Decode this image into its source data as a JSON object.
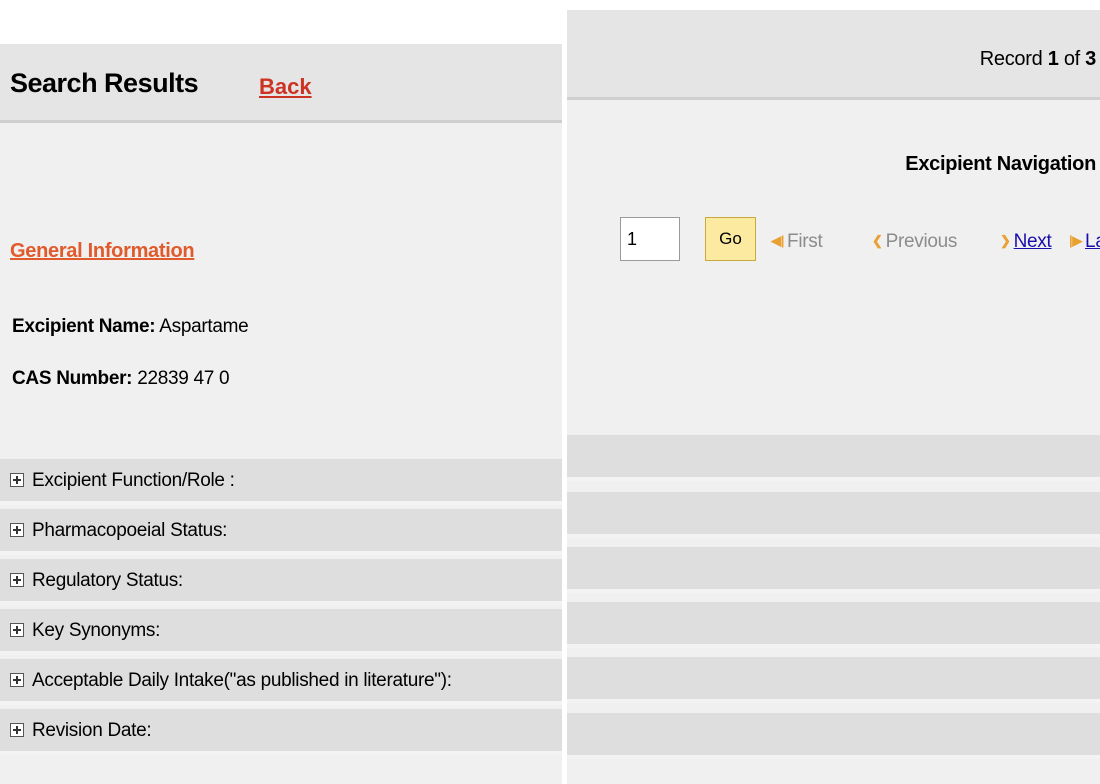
{
  "left": {
    "title": "Search Results",
    "back_label": "Back",
    "section_link": "General Information",
    "excipient_name_label": "Excipient Name:",
    "excipient_name_value": "Aspartame",
    "cas_label": "CAS Number:",
    "cas_value": "22839 47 0",
    "accordion": [
      "Excipient Function/Role :",
      "Pharmacopoeial Status:",
      "Regulatory Status:",
      "Key Synonyms:",
      "Acceptable Daily Intake(\"as published in literature\"):",
      "Revision Date:"
    ]
  },
  "right": {
    "record_prefix": "Record",
    "record_current": "1",
    "record_of": "of",
    "record_total": "3",
    "nav_title": "Excipient Navigation",
    "page_input_value": "1",
    "go_label": "Go",
    "first_label": "First",
    "previous_label": "Previous",
    "next_label": "Next",
    "last_label": "Last"
  },
  "colors": {
    "back_link": "#cc3322",
    "section_link": "#e05a2b",
    "active_link": "#1a0dab",
    "disabled_link": "#8c8c8c",
    "go_button": "#fbeaa0",
    "arrow_accent": "#e8a030"
  },
  "icons": {
    "accordion_expand": "plus-box-icon",
    "first": "first-arrow-icon",
    "previous": "previous-arrow-icon",
    "next": "next-arrow-icon",
    "last": "last-arrow-icon"
  }
}
